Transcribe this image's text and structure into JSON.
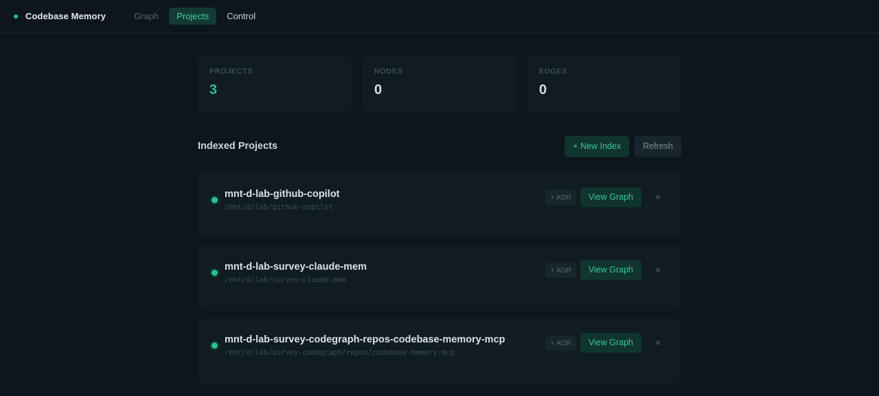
{
  "app": {
    "title": "Codebase Memory"
  },
  "nav": {
    "tabs": [
      {
        "label": "Graph"
      },
      {
        "label": "Projects"
      },
      {
        "label": "Control"
      }
    ]
  },
  "stats": {
    "projects": {
      "label": "PROJECTS",
      "value": "3"
    },
    "nodes": {
      "label": "NODES",
      "value": "0"
    },
    "edges": {
      "label": "EDGES",
      "value": "0"
    }
  },
  "section": {
    "title": "Indexed Projects",
    "new_index_label": "+ New Index",
    "refresh_label": "Refresh"
  },
  "projects": [
    {
      "name": "mnt-d-lab-github-copilot",
      "path": "/mnt/d/lab/github-copilot",
      "adr_label": "+ ADR",
      "view_label": "View Graph",
      "remove_label": "×"
    },
    {
      "name": "mnt-d-lab-survey-claude-mem",
      "path": "/mnt/d/lab/survey-claude-mem",
      "adr_label": "+ ADR",
      "view_label": "View Graph",
      "remove_label": "×"
    },
    {
      "name": "mnt-d-lab-survey-codegraph-repos-codebase-memory-mcp",
      "path": "/mnt/d/lab/survey-codegraph/repos/codebase-memory-mcp",
      "adr_label": "+ ADR",
      "view_label": "View Graph",
      "remove_label": "×"
    }
  ],
  "colors": {
    "background": "#0c161c",
    "card": "#101c22",
    "accent": "#27c28b",
    "accent_bg": "#10342e"
  }
}
